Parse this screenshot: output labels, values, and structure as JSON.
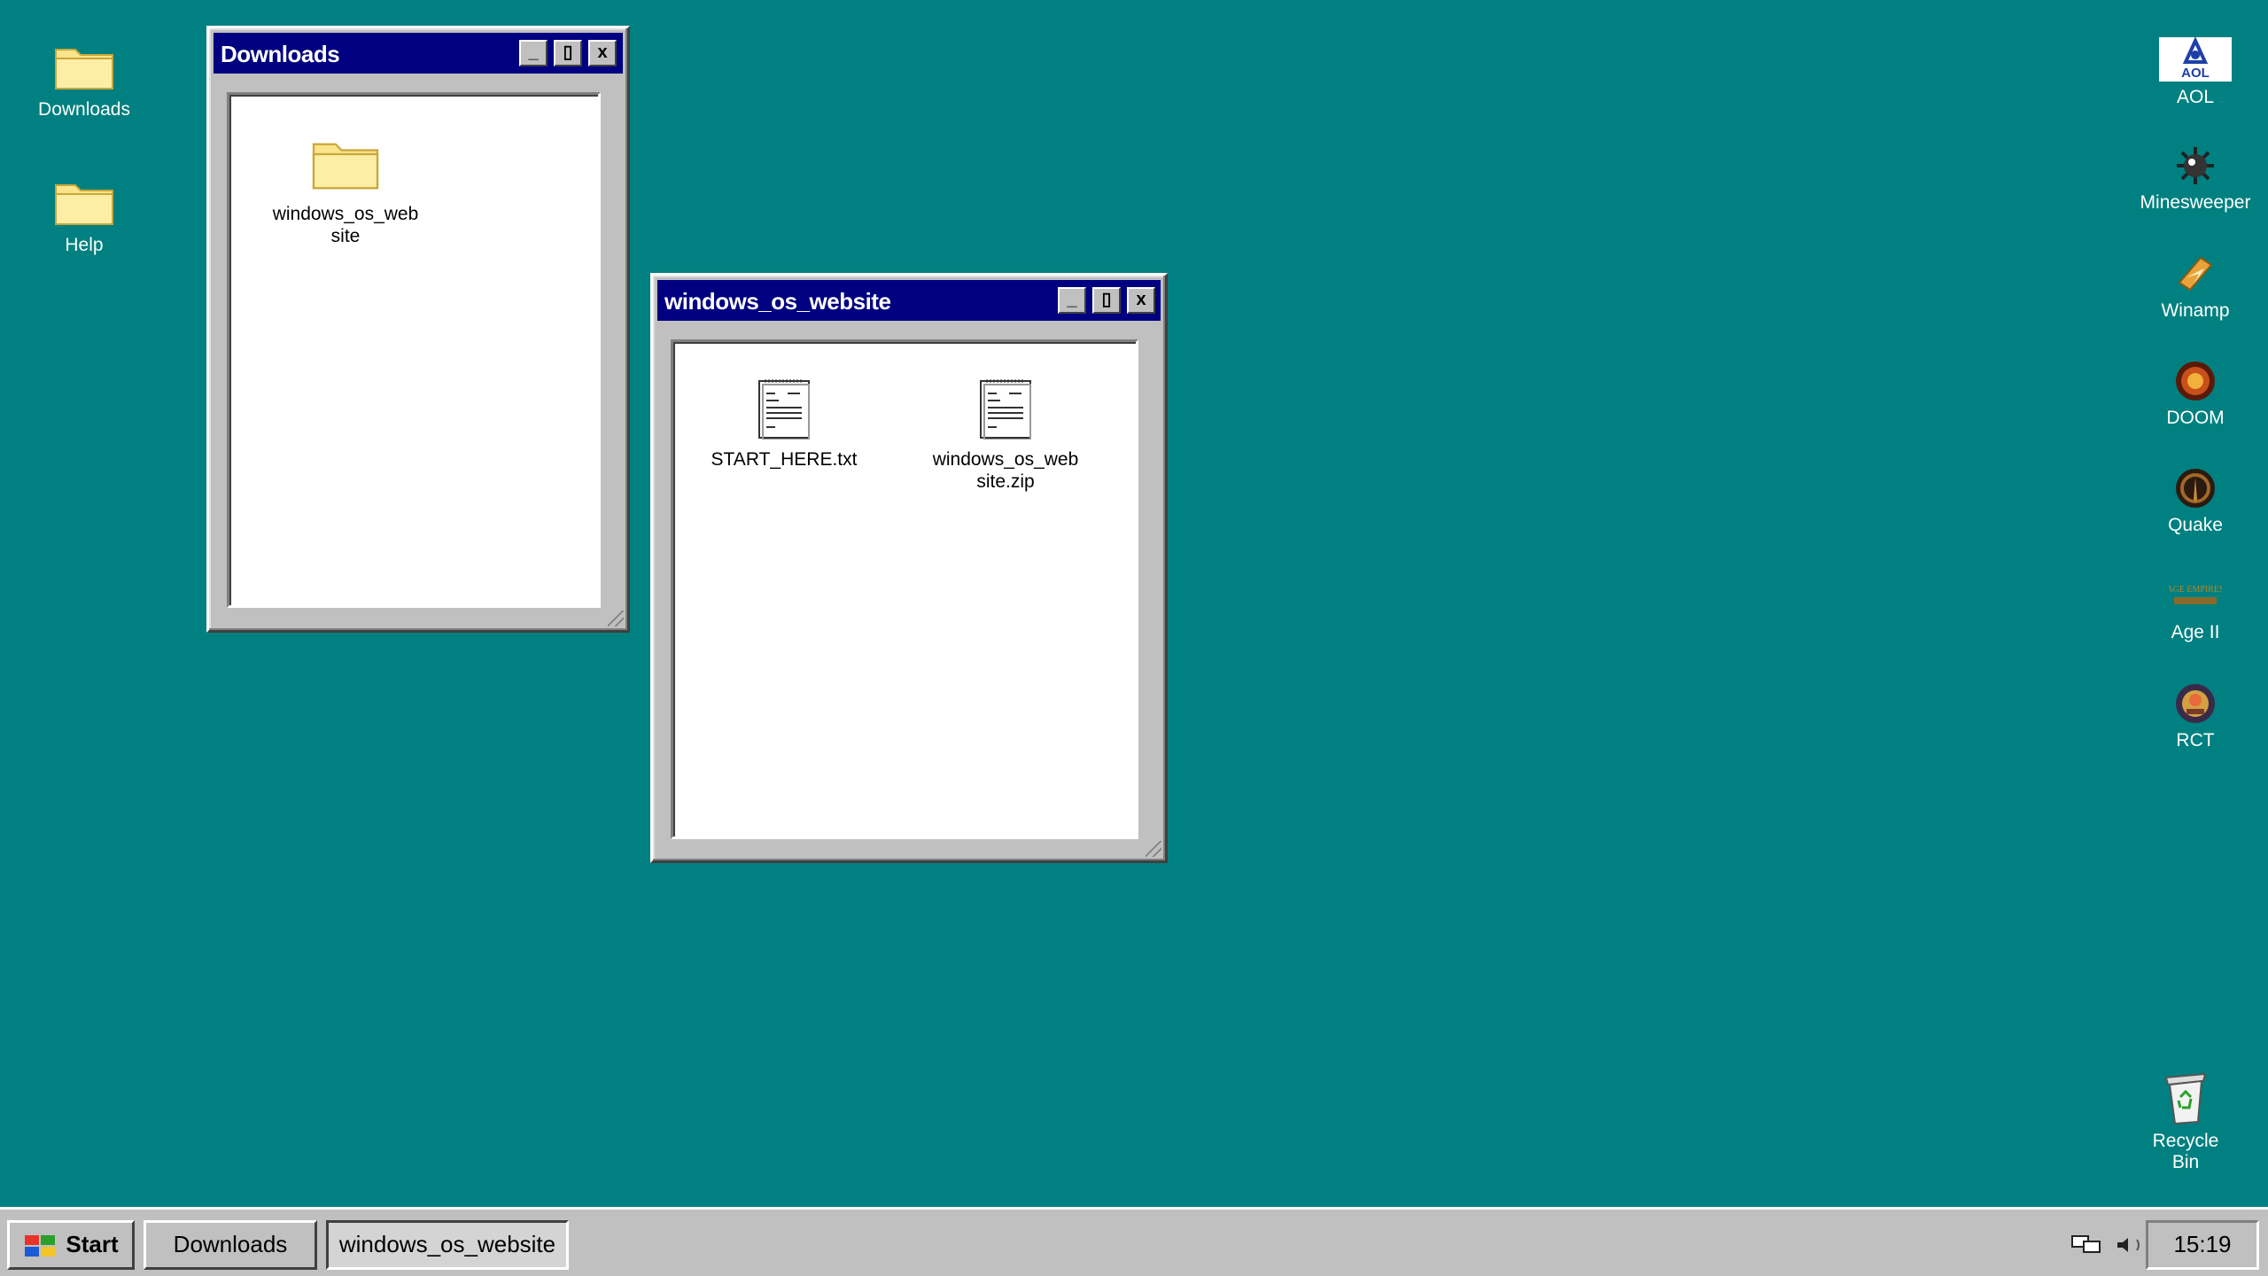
{
  "desktop": {
    "left_icons": [
      {
        "label": "Downloads",
        "icon": "folder-icon"
      },
      {
        "label": "Help",
        "icon": "folder-icon"
      }
    ],
    "right_icons": [
      {
        "label": "AOL",
        "icon": "aol-icon"
      },
      {
        "label": "Minesweeper",
        "icon": "minesweeper-icon"
      },
      {
        "label": "Winamp",
        "icon": "winamp-icon"
      },
      {
        "label": "DOOM",
        "icon": "doom-icon"
      },
      {
        "label": "Quake",
        "icon": "quake-icon"
      },
      {
        "label": "Age II",
        "icon": "age-of-empires-icon"
      },
      {
        "label": "RCT",
        "icon": "rollercoaster-tycoon-icon"
      }
    ],
    "recycle_bin": {
      "label": "Recycle Bin",
      "icon": "recycle-bin-icon"
    },
    "aol_logo_text": "AOL",
    "age_logo_text": "AGE EMPIRES"
  },
  "windows": {
    "downloads": {
      "title": "Downloads",
      "items": [
        {
          "label": "windows_os_website",
          "icon": "folder-icon"
        }
      ]
    },
    "website": {
      "title": "windows_os_website",
      "items": [
        {
          "label": "START_HERE.txt",
          "icon": "text-file-icon"
        },
        {
          "label": "windows_os_website.zip",
          "icon": "text-file-icon"
        }
      ]
    },
    "buttons": {
      "minimize": "_",
      "maximize": "▯",
      "close": "x"
    }
  },
  "taskbar": {
    "start_label": "Start",
    "tasks": [
      {
        "label": "Downloads"
      },
      {
        "label": "windows_os_website"
      }
    ],
    "clock": "15:19"
  },
  "colors": {
    "desktop": "#008080",
    "titlebar": "#000080",
    "chrome": "#c0c0c0"
  }
}
